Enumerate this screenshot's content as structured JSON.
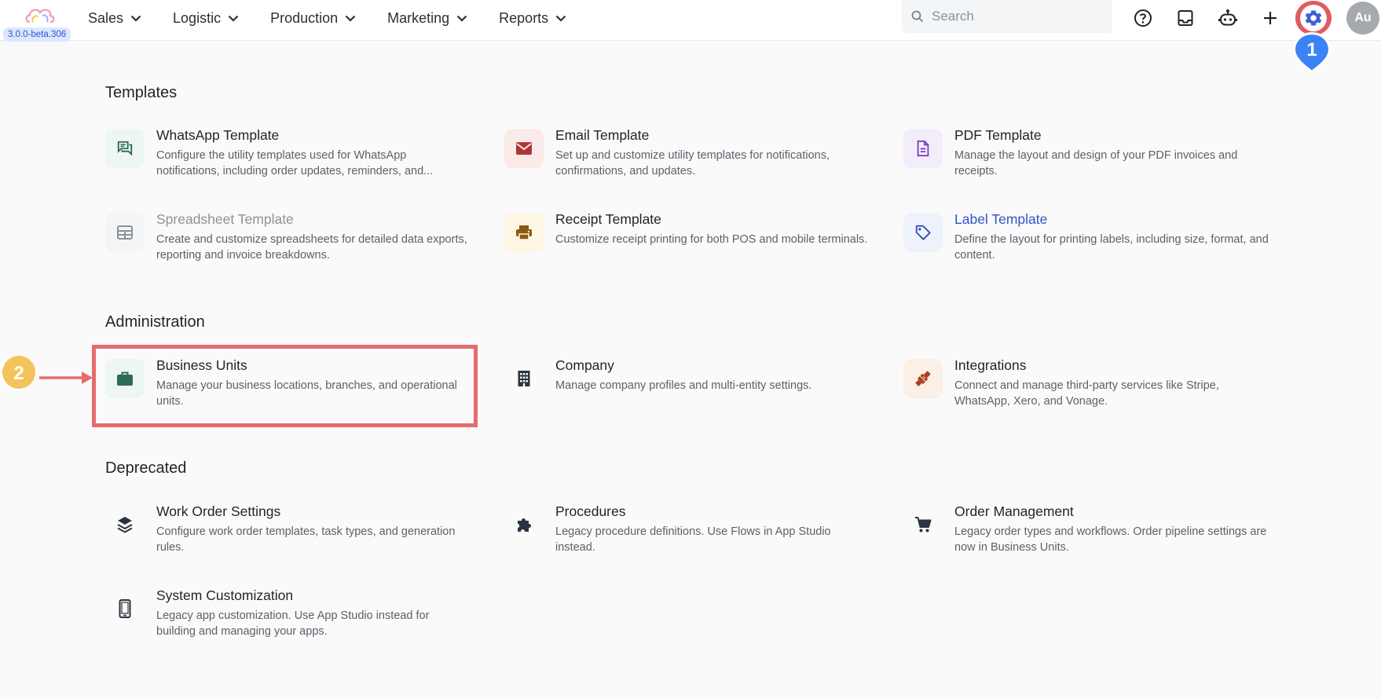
{
  "app": {
    "version": "3.0.0-beta.306"
  },
  "nav": [
    {
      "label": "Sales"
    },
    {
      "label": "Logistic"
    },
    {
      "label": "Production"
    },
    {
      "label": "Marketing"
    },
    {
      "label": "Reports"
    }
  ],
  "search": {
    "placeholder": "Search",
    "value": ""
  },
  "toolbar": {
    "help_icon": "help-circle-icon",
    "inbox_icon": "inbox-icon",
    "bot_icon": "robot-icon",
    "add_icon": "plus-icon",
    "settings_icon": "gear-icon"
  },
  "user": {
    "initials": "Au"
  },
  "markers": {
    "one": "1",
    "two": "2"
  },
  "colors": {
    "accent": "#2f55c7",
    "highlight": "#e46c6e",
    "marker_blue": "#3b82f6",
    "marker_yellow": "#f4c45a"
  },
  "sections": {
    "templates": {
      "title": "Templates",
      "items": [
        {
          "title": "WhatsApp Template",
          "desc": "Configure the utility templates used for WhatsApp notifications, including order updates, reminders, and...",
          "icon": "chat-icon"
        },
        {
          "title": "Email Template",
          "desc": "Set up and customize utility templates for notifications, confirmations, and updates.",
          "icon": "mail-icon"
        },
        {
          "title": "PDF Template",
          "desc": "Manage the layout and design of your PDF invoices and receipts.",
          "icon": "document-icon"
        },
        {
          "title": "Spreadsheet Template",
          "desc": "Create and customize spreadsheets for detailed data exports, reporting and invoice breakdowns.",
          "icon": "table-icon"
        },
        {
          "title": "Receipt Template",
          "desc": "Customize receipt printing for both POS and mobile terminals.",
          "icon": "printer-icon"
        },
        {
          "title": "Label Template",
          "desc": "Define the layout for printing labels, including size, format, and content.",
          "icon": "tag-icon"
        }
      ]
    },
    "administration": {
      "title": "Administration",
      "items": [
        {
          "title": "Business Units",
          "desc": "Manage your business locations, branches, and operational units.",
          "icon": "briefcase-icon"
        },
        {
          "title": "Company",
          "desc": "Manage company profiles and multi-entity settings.",
          "icon": "building-icon"
        },
        {
          "title": "Integrations",
          "desc": "Connect and manage third-party services like Stripe, WhatsApp, Xero, and Vonage.",
          "icon": "plug-icon"
        }
      ]
    },
    "deprecated": {
      "title": "Deprecated",
      "items": [
        {
          "title": "Work Order Settings",
          "desc": "Configure work order templates, task types, and generation rules.",
          "icon": "layers-icon"
        },
        {
          "title": "Procedures",
          "desc": "Legacy procedure definitions. Use Flows in App Studio instead.",
          "icon": "puzzle-icon"
        },
        {
          "title": "Order Management",
          "desc": "Legacy order types and workflows. Order pipeline settings are now in Business Units.",
          "icon": "cart-icon"
        },
        {
          "title": "System Customization",
          "desc": "Legacy app customization. Use App Studio instead for building and managing your apps.",
          "icon": "phone-icon"
        }
      ]
    }
  }
}
